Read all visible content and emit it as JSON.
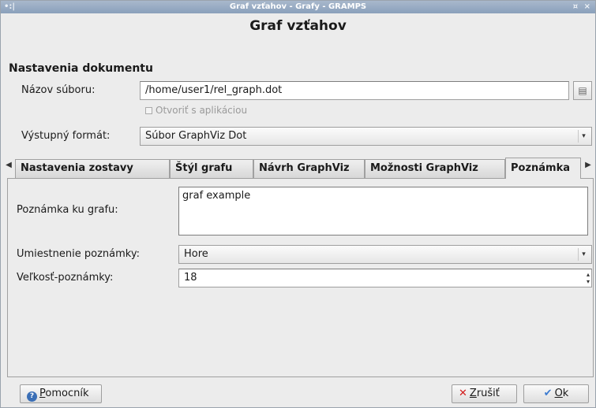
{
  "window": {
    "title": "Graf vzťahov - Grafy - GRAMPS",
    "left_glyph": "•:|",
    "right_glyph": "¤ ×"
  },
  "dialog": {
    "heading": "Graf vzťahov"
  },
  "document_settings": {
    "section_title": "Nastavenia dokumentu",
    "filename_label": "Názov súboru:",
    "filename_value": "/home/user1/rel_graph.dot",
    "browse_icon": "folder-icon",
    "open_with_app_label": "Otvoriť s aplikáciou",
    "open_with_app_checked": false,
    "output_format_label": "Výstupný formát:",
    "output_format_value": "Súbor GraphViz Dot"
  },
  "tabs": [
    {
      "label": "Nastavenia zostavy",
      "active": false
    },
    {
      "label": "Štýl grafu",
      "active": false
    },
    {
      "label": "Návrh GraphViz",
      "active": false
    },
    {
      "label": "Možnosti GraphViz",
      "active": false
    },
    {
      "label": "Poznámka",
      "active": true
    }
  ],
  "note_tab": {
    "note_label": "Poznámka ku grafu:",
    "note_value": "graf example",
    "position_label": "Umiestnenie poznámky:",
    "position_value": "Hore",
    "size_label": "Veľkosť-poznámky:",
    "size_value": "18"
  },
  "buttons": {
    "help": {
      "first": "P",
      "rest": "omocník"
    },
    "cancel": {
      "first": "Z",
      "rest": "rušiť"
    },
    "ok": {
      "first": "O",
      "rest": "k"
    }
  },
  "colors": {
    "titlebar": "#8aa0bb",
    "cancel_icon": "#d21b1b",
    "help_icon": "#3b6fb6"
  }
}
